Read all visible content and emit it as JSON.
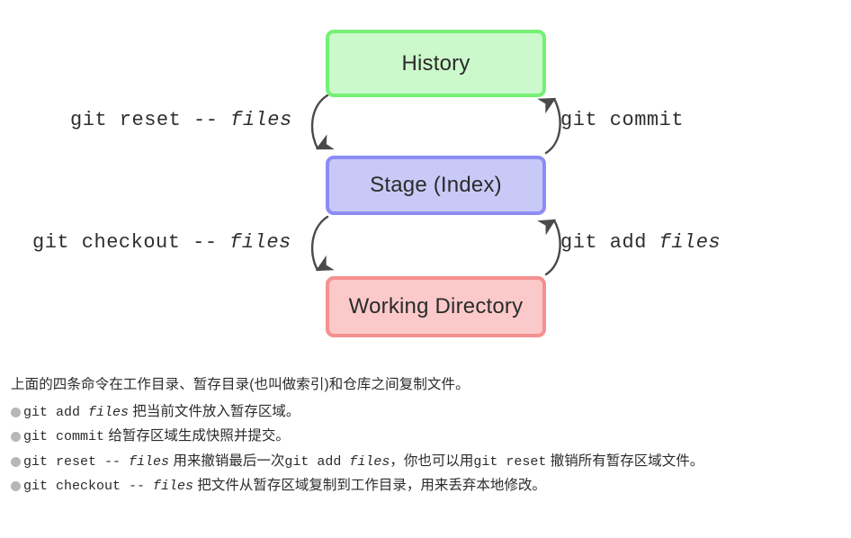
{
  "diagram": {
    "nodes": [
      {
        "id": "history",
        "label": "History",
        "border_color": "#74f074",
        "fill_color": "#ccf9cc"
      },
      {
        "id": "stage",
        "label": "Stage (Index)",
        "border_color": "#8c8cf5",
        "fill_color": "#c9c9f7"
      },
      {
        "id": "working",
        "label": "Working Directory",
        "border_color": "#f59090",
        "fill_color": "#fbc9c9"
      }
    ],
    "arrows": [
      {
        "id": "reset",
        "command": "git reset -- ",
        "argument": "files",
        "direction": "history-to-stage",
        "side": "left"
      },
      {
        "id": "commit",
        "command": "git commit",
        "argument": "",
        "direction": "stage-to-history",
        "side": "right"
      },
      {
        "id": "checkout",
        "command": "git checkout -- ",
        "argument": "files",
        "direction": "stage-to-working",
        "side": "left"
      },
      {
        "id": "add",
        "command": "git add ",
        "argument": "files",
        "direction": "working-to-stage",
        "side": "right"
      }
    ],
    "arrow_color": "#4a4a4a"
  },
  "text": {
    "intro": "上面的四条命令在工作目录、暂存目录(也叫做索引)和仓库之间复制文件。",
    "bullets": [
      {
        "code_1": "git add ",
        "code_1_em": "files",
        "text_1": " 把当前文件放入暂存区域。",
        "code_2": "",
        "code_2_em": "",
        "text_2": ""
      },
      {
        "code_1": "git commit",
        "code_1_em": "",
        "text_1": " 给暂存区域生成快照并提交。",
        "code_2": "",
        "code_2_em": "",
        "text_2": ""
      },
      {
        "code_1": "git reset -- ",
        "code_1_em": "files",
        "text_1": " 用来撤销最后一次",
        "code_2": "git add ",
        "code_2_em": "files",
        "text_2": "，你也可以用",
        "code_3": "git reset",
        "text_3": " 撤销所有暂存区域文件。"
      },
      {
        "code_1": "git checkout -- ",
        "code_1_em": "files",
        "text_1": " 把文件从暂存区域复制到工作目录，用来丢弃本地修改。",
        "code_2": "",
        "code_2_em": "",
        "text_2": ""
      }
    ],
    "bullet_color": "#b7b7b7"
  }
}
